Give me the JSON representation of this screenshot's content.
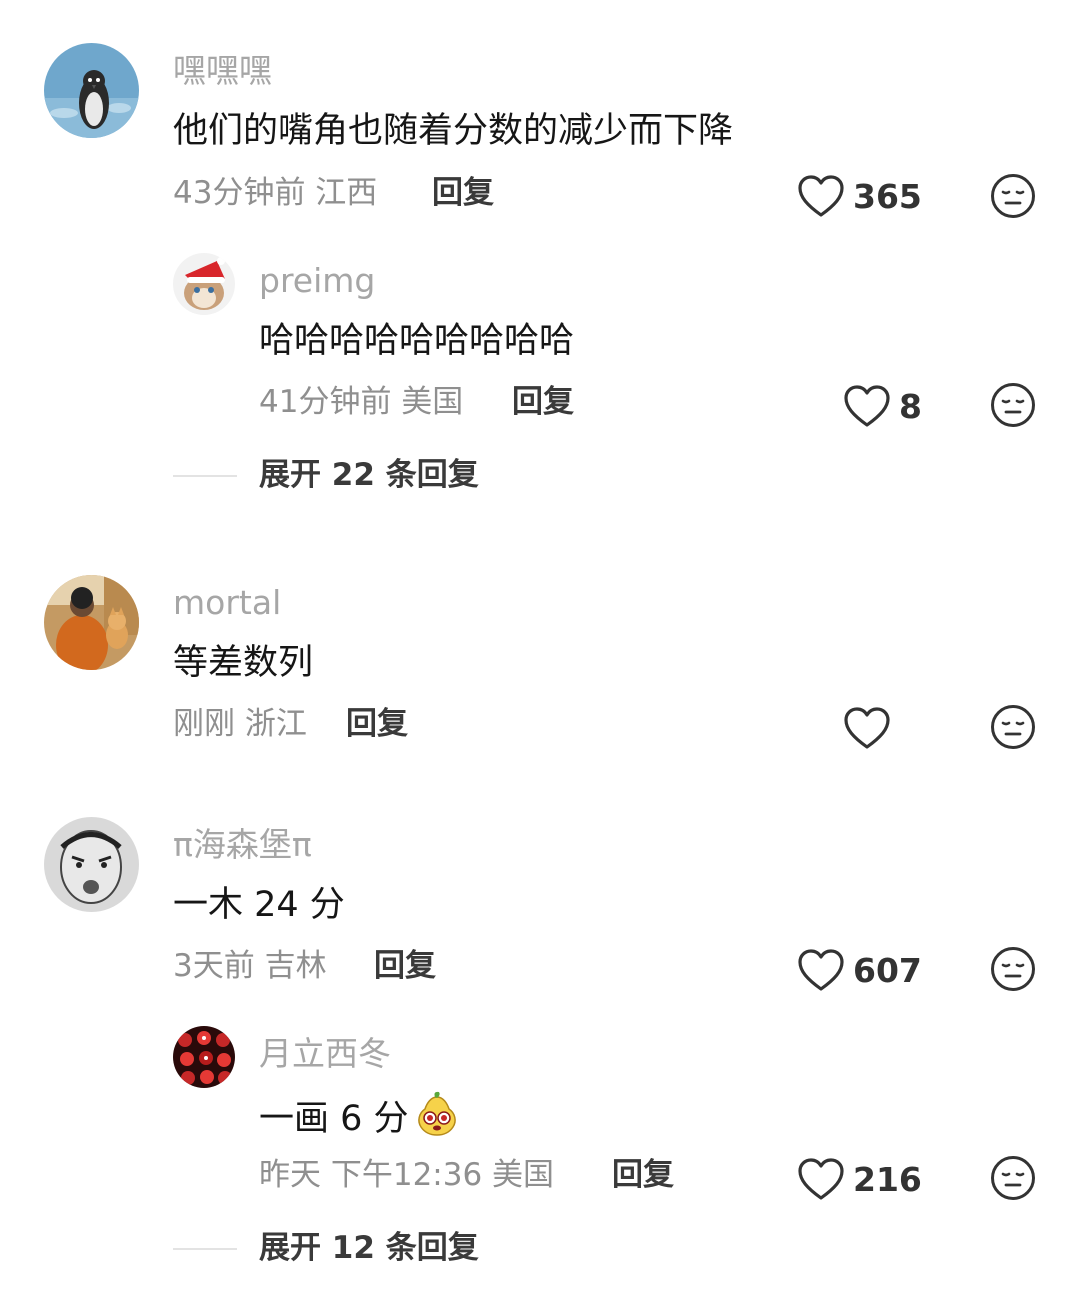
{
  "comments": [
    {
      "username": "嘿嘿嘿",
      "text": "他们的嘴角也随着分数的减少而下降",
      "time_location": "43分钟前 江西",
      "reply_label": "回复",
      "likes": "365",
      "avatar": "penguin-photo",
      "replies": [
        {
          "username": "preimg",
          "text": "哈哈哈哈哈哈哈哈哈",
          "time_location": "41分钟前 美国",
          "reply_label": "回复",
          "likes": "8",
          "avatar": "cartoon-fox-santa-hat"
        }
      ],
      "expand_label": "展开 22 条回复"
    },
    {
      "username": "mortal",
      "text": "等差数列",
      "time_location": "刚刚 浙江",
      "reply_label": "回复",
      "likes": "",
      "avatar": "person-with-dog-photo"
    },
    {
      "username": "π海森堡π",
      "text": "一木 24 分",
      "time_location": "3天前 吉林",
      "reply_label": "回复",
      "likes": "607",
      "avatar": "sketch-face-drawing",
      "replies": [
        {
          "username": "月立西冬",
          "text": "一画 6 分",
          "emoji": "pear-face-emoji",
          "time_location": "昨天 下午12:36 美国",
          "reply_label": "回复",
          "likes": "216",
          "avatar": "red-pattern-photo"
        }
      ],
      "expand_label": "展开 12 条回复"
    }
  ],
  "icons": {
    "like": "heart-outline-icon",
    "dislike": "neutral-face-icon"
  },
  "colors": {
    "username": "#a6a6a6",
    "comment_text": "#161616",
    "meta": "#8f8f8f",
    "action": "#3a3a3a",
    "icon_stroke": "#333333"
  }
}
